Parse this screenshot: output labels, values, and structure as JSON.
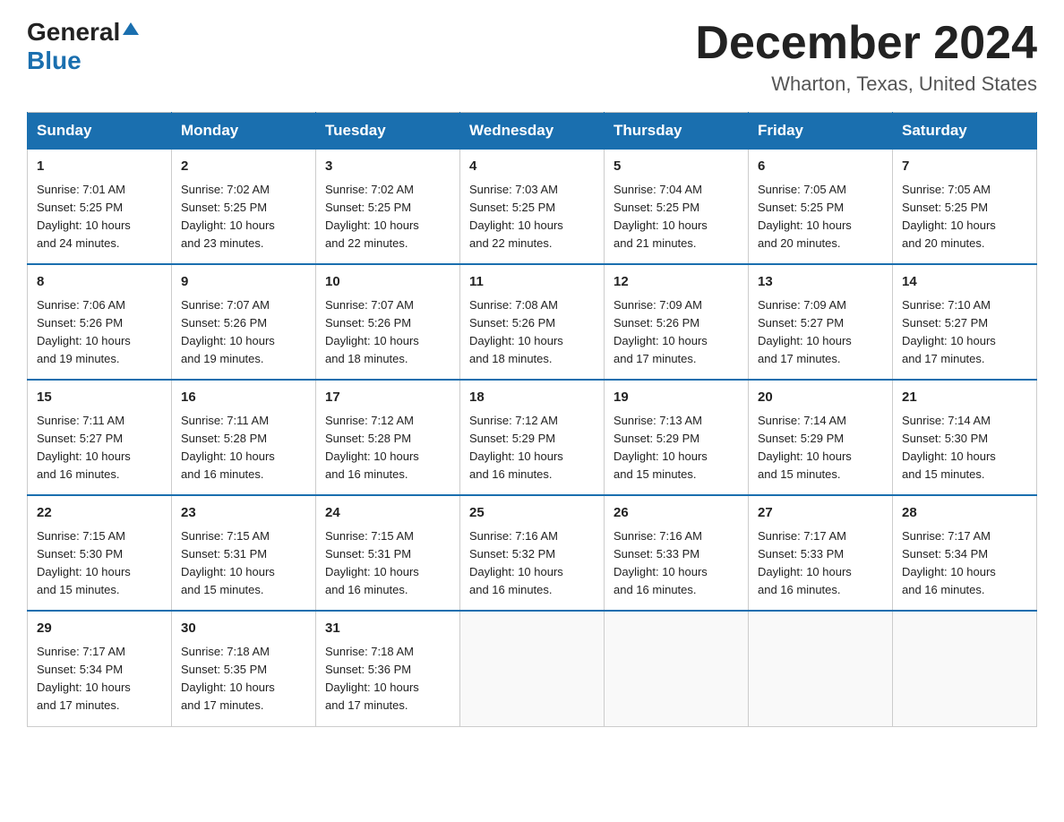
{
  "logo": {
    "general": "General",
    "blue": "Blue",
    "triangle": "▲"
  },
  "title": "December 2024",
  "subtitle": "Wharton, Texas, United States",
  "weekdays": [
    "Sunday",
    "Monday",
    "Tuesday",
    "Wednesday",
    "Thursday",
    "Friday",
    "Saturday"
  ],
  "weeks": [
    [
      {
        "day": "1",
        "sunrise": "7:01 AM",
        "sunset": "5:25 PM",
        "daylight": "10 hours and 24 minutes."
      },
      {
        "day": "2",
        "sunrise": "7:02 AM",
        "sunset": "5:25 PM",
        "daylight": "10 hours and 23 minutes."
      },
      {
        "day": "3",
        "sunrise": "7:02 AM",
        "sunset": "5:25 PM",
        "daylight": "10 hours and 22 minutes."
      },
      {
        "day": "4",
        "sunrise": "7:03 AM",
        "sunset": "5:25 PM",
        "daylight": "10 hours and 22 minutes."
      },
      {
        "day": "5",
        "sunrise": "7:04 AM",
        "sunset": "5:25 PM",
        "daylight": "10 hours and 21 minutes."
      },
      {
        "day": "6",
        "sunrise": "7:05 AM",
        "sunset": "5:25 PM",
        "daylight": "10 hours and 20 minutes."
      },
      {
        "day": "7",
        "sunrise": "7:05 AM",
        "sunset": "5:25 PM",
        "daylight": "10 hours and 20 minutes."
      }
    ],
    [
      {
        "day": "8",
        "sunrise": "7:06 AM",
        "sunset": "5:26 PM",
        "daylight": "10 hours and 19 minutes."
      },
      {
        "day": "9",
        "sunrise": "7:07 AM",
        "sunset": "5:26 PM",
        "daylight": "10 hours and 19 minutes."
      },
      {
        "day": "10",
        "sunrise": "7:07 AM",
        "sunset": "5:26 PM",
        "daylight": "10 hours and 18 minutes."
      },
      {
        "day": "11",
        "sunrise": "7:08 AM",
        "sunset": "5:26 PM",
        "daylight": "10 hours and 18 minutes."
      },
      {
        "day": "12",
        "sunrise": "7:09 AM",
        "sunset": "5:26 PM",
        "daylight": "10 hours and 17 minutes."
      },
      {
        "day": "13",
        "sunrise": "7:09 AM",
        "sunset": "5:27 PM",
        "daylight": "10 hours and 17 minutes."
      },
      {
        "day": "14",
        "sunrise": "7:10 AM",
        "sunset": "5:27 PM",
        "daylight": "10 hours and 17 minutes."
      }
    ],
    [
      {
        "day": "15",
        "sunrise": "7:11 AM",
        "sunset": "5:27 PM",
        "daylight": "10 hours and 16 minutes."
      },
      {
        "day": "16",
        "sunrise": "7:11 AM",
        "sunset": "5:28 PM",
        "daylight": "10 hours and 16 minutes."
      },
      {
        "day": "17",
        "sunrise": "7:12 AM",
        "sunset": "5:28 PM",
        "daylight": "10 hours and 16 minutes."
      },
      {
        "day": "18",
        "sunrise": "7:12 AM",
        "sunset": "5:29 PM",
        "daylight": "10 hours and 16 minutes."
      },
      {
        "day": "19",
        "sunrise": "7:13 AM",
        "sunset": "5:29 PM",
        "daylight": "10 hours and 15 minutes."
      },
      {
        "day": "20",
        "sunrise": "7:14 AM",
        "sunset": "5:29 PM",
        "daylight": "10 hours and 15 minutes."
      },
      {
        "day": "21",
        "sunrise": "7:14 AM",
        "sunset": "5:30 PM",
        "daylight": "10 hours and 15 minutes."
      }
    ],
    [
      {
        "day": "22",
        "sunrise": "7:15 AM",
        "sunset": "5:30 PM",
        "daylight": "10 hours and 15 minutes."
      },
      {
        "day": "23",
        "sunrise": "7:15 AM",
        "sunset": "5:31 PM",
        "daylight": "10 hours and 15 minutes."
      },
      {
        "day": "24",
        "sunrise": "7:15 AM",
        "sunset": "5:31 PM",
        "daylight": "10 hours and 16 minutes."
      },
      {
        "day": "25",
        "sunrise": "7:16 AM",
        "sunset": "5:32 PM",
        "daylight": "10 hours and 16 minutes."
      },
      {
        "day": "26",
        "sunrise": "7:16 AM",
        "sunset": "5:33 PM",
        "daylight": "10 hours and 16 minutes."
      },
      {
        "day": "27",
        "sunrise": "7:17 AM",
        "sunset": "5:33 PM",
        "daylight": "10 hours and 16 minutes."
      },
      {
        "day": "28",
        "sunrise": "7:17 AM",
        "sunset": "5:34 PM",
        "daylight": "10 hours and 16 minutes."
      }
    ],
    [
      {
        "day": "29",
        "sunrise": "7:17 AM",
        "sunset": "5:34 PM",
        "daylight": "10 hours and 17 minutes."
      },
      {
        "day": "30",
        "sunrise": "7:18 AM",
        "sunset": "5:35 PM",
        "daylight": "10 hours and 17 minutes."
      },
      {
        "day": "31",
        "sunrise": "7:18 AM",
        "sunset": "5:36 PM",
        "daylight": "10 hours and 17 minutes."
      },
      null,
      null,
      null,
      null
    ]
  ],
  "labels": {
    "sunrise": "Sunrise:",
    "sunset": "Sunset:",
    "daylight": "Daylight:"
  }
}
